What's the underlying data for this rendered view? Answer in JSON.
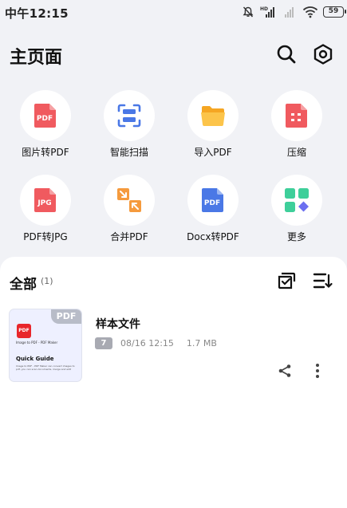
{
  "status_bar": {
    "time": "中午12:15",
    "network_badge": "HD",
    "battery": "59"
  },
  "header": {
    "title": "主页面"
  },
  "tools": [
    {
      "label": "图片转PDF",
      "icon": "pdf-file-icon",
      "color": "#f05a5f",
      "text": "PDF"
    },
    {
      "label": "智能扫描",
      "icon": "scan-icon",
      "color": "#4a78e6",
      "text": ""
    },
    {
      "label": "导入PDF",
      "icon": "folder-icon",
      "color": "#f5a623",
      "text": ""
    },
    {
      "label": "压缩",
      "icon": "compress-icon",
      "color": "#f05a5f",
      "text": ""
    },
    {
      "label": "PDF转JPG",
      "icon": "jpg-file-icon",
      "color": "#f05a5f",
      "text": "JPG"
    },
    {
      "label": "合并PDF",
      "icon": "merge-icon",
      "color": "#f59a3d",
      "text": ""
    },
    {
      "label": "Docx转PDF",
      "icon": "pdf-doc-icon",
      "color": "#4a78e6",
      "text": "PDF"
    },
    {
      "label": "更多",
      "icon": "more-apps-icon",
      "color": "#3ecf9a",
      "text": ""
    }
  ],
  "files": {
    "section_title": "全部",
    "count": "(1)",
    "items": [
      {
        "name": "样本文件",
        "pages": "7",
        "date": "08/16 12:15",
        "size": "1.7 MB",
        "thumb": {
          "tag": "PDF",
          "logo": "PDF",
          "line1": "Image to PDF - PDF Maker",
          "guide": "Quick Guide",
          "small": "Image to PDF - PDF Maker can convert images to pdf, you can scan documents, merge and edit"
        }
      }
    ]
  }
}
